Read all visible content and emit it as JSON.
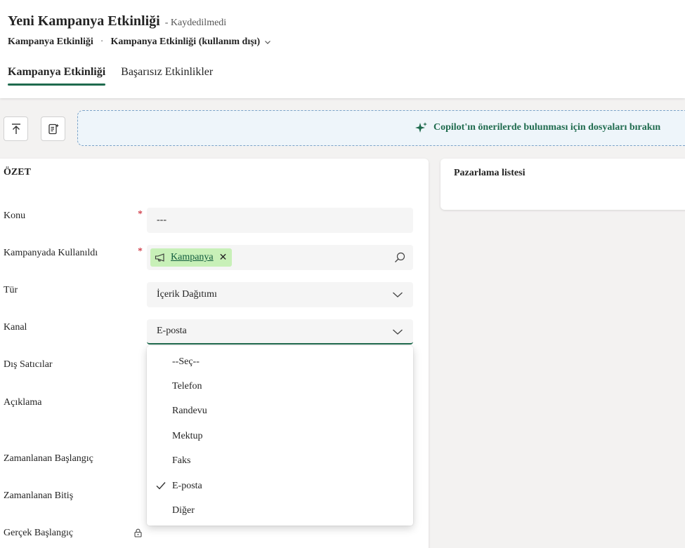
{
  "header": {
    "title": "Yeni Kampanya Etkinliği",
    "status": "- Kaydedilmedi",
    "breadcrumb_entity": "Kampanya Etkinliği",
    "breadcrumb_separator": "·",
    "breadcrumb_form": "Kampanya Etkinliği (kullanım dışı)"
  },
  "tabs": [
    {
      "label": "Kampanya Etkinliği",
      "active": true
    },
    {
      "label": "Başarısız Etkinlikler",
      "active": false
    }
  ],
  "toolbar": {
    "upload_icon": "upload-icon",
    "copilot_form_icon": "form-assist-icon"
  },
  "dropzone": {
    "icon": "sparkle-icon",
    "text": "Copilot'ın önerilerde bulunması için dosyaları bırakın"
  },
  "summary": {
    "title": "ÖZET",
    "fields": {
      "subject": {
        "label": "Konu",
        "value": "---",
        "required": true
      },
      "used_in_campaign": {
        "label": "Kampanyada Kullanıldı",
        "tag": "Kampanya",
        "required": true
      },
      "type": {
        "label": "Tür",
        "value": "İçerik Dağıtımı"
      },
      "channel": {
        "label": "Kanal",
        "value": "E-posta"
      },
      "vendors": {
        "label": "Dış Satıcılar"
      },
      "description": {
        "label": "Açıklama"
      },
      "scheduled_start": {
        "label": "Zamanlanan Başlangıç"
      },
      "scheduled_end": {
        "label": "Zamanlanan Bitiş"
      },
      "actual_start": {
        "label": "Gerçek Başlangıç"
      }
    },
    "required_mark": "*"
  },
  "channel_dropdown": {
    "options": [
      "--Seç--",
      "Telefon",
      "Randevu",
      "Mektup",
      "Faks",
      "E-posta",
      "Diğer"
    ],
    "selected": "E-posta"
  },
  "marketing_list": {
    "title": "Pazarlama listesi"
  },
  "colors": {
    "accent": "#1f6b4e",
    "tag_bg": "#c8f0b8",
    "required": "#c50f1f"
  }
}
